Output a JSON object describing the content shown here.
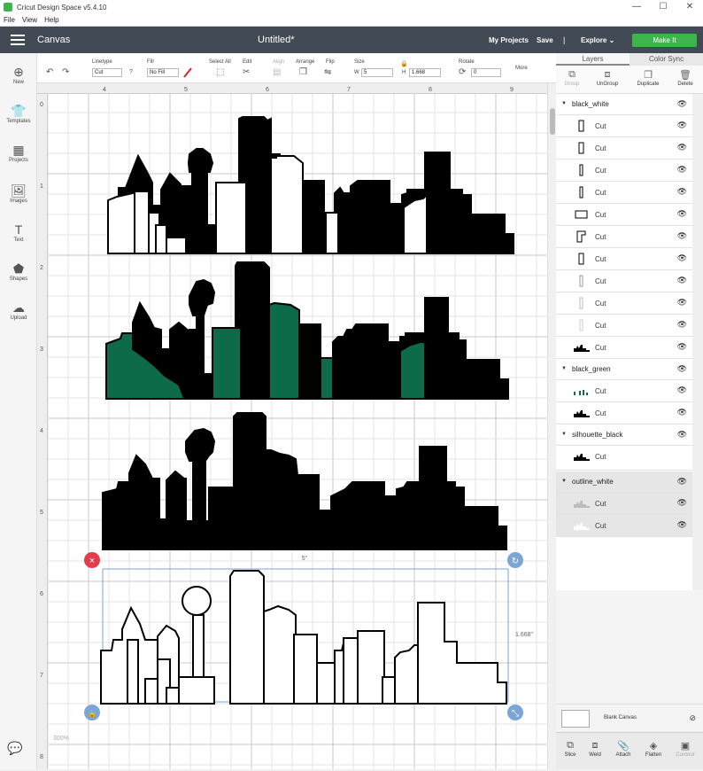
{
  "window": {
    "title": "Cricut Design Space  v5.4.10",
    "minimize": "—",
    "maximize": "☐",
    "close": "✕"
  },
  "menu": [
    "File",
    "View",
    "Help"
  ],
  "header": {
    "nav_label": "Canvas",
    "doc_title": "Untitled*",
    "my_projects": "My Projects",
    "save": "Save",
    "separator": "|",
    "explore": "Explore",
    "make_it": "Make It",
    "accent": "#3cb54a",
    "bar_color": "#414a55"
  },
  "toolbar": {
    "linetype_label": "Linetype",
    "linetype_value": "Cut",
    "fill_label": "Fill",
    "fill_value": "No Fill",
    "select_all": "Select All",
    "edit": "Edit",
    "align": "Align",
    "arrange": "Arrange",
    "flip": "Flip",
    "size": "Size",
    "w_label": "W",
    "w_value": "5",
    "h_label": "H",
    "h_value": "1.668",
    "rotate": "Rotate",
    "rotate_value": "0",
    "more": "More"
  },
  "leftbar": [
    "New",
    "Templates",
    "Projects",
    "Images",
    "Text",
    "Shapes",
    "Upload"
  ],
  "rulers": {
    "top_ticks": [
      "4",
      "5",
      "6",
      "7",
      "8",
      "9"
    ],
    "left_ticks": [
      "0",
      "1",
      "2",
      "3",
      "4",
      "5",
      "6",
      "7",
      "8"
    ]
  },
  "canvas": {
    "width_label": "5\"",
    "height_label": "1.668\"",
    "fill_green": "#0e6b4a",
    "selection_color": "#7aa6d6",
    "delete_color": "#e23b4a"
  },
  "panel": {
    "tab_layers": "Layers",
    "tab_color_sync": "Color Sync",
    "group": "Group",
    "ungroup": "UnGroup",
    "duplicate": "Duplicate",
    "delete": "Delete",
    "groups": [
      {
        "name": "black_white",
        "items": [
          "Cut",
          "Cut",
          "Cut",
          "Cut",
          "Cut",
          "Cut",
          "Cut",
          "Cut",
          "Cut",
          "Cut",
          "Cut"
        ]
      },
      {
        "name": "black_green",
        "items": [
          "Cut",
          "Cut"
        ]
      },
      {
        "name": "silhouette_black",
        "items": [
          "Cut"
        ]
      },
      {
        "name": "outline_white",
        "items": [
          "Cut",
          "Cut"
        ]
      }
    ],
    "blank_canvas": "Blank Canvas",
    "bottom": [
      "Slice",
      "Weld",
      "Attach",
      "Flatten",
      "Contour"
    ]
  },
  "zoom": "300%"
}
